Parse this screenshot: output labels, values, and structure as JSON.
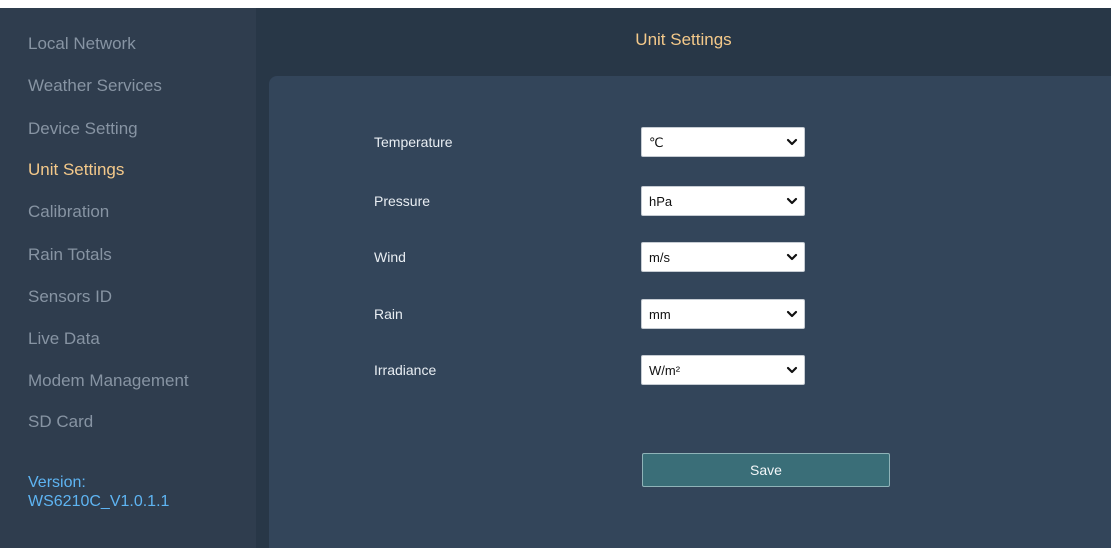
{
  "sidebar": {
    "items": [
      {
        "label": "Local Network",
        "active": false
      },
      {
        "label": "Weather Services",
        "active": false
      },
      {
        "label": "Device Setting",
        "active": false
      },
      {
        "label": "Unit Settings",
        "active": true
      },
      {
        "label": "Calibration",
        "active": false
      },
      {
        "label": "Rain Totals",
        "active": false
      },
      {
        "label": "Sensors ID",
        "active": false
      },
      {
        "label": "Live Data",
        "active": false
      },
      {
        "label": "Modem Management",
        "active": false
      },
      {
        "label": "SD Card",
        "active": false
      }
    ],
    "version_label": "Version:",
    "version_value": "WS6210C_V1.0.1.1"
  },
  "header": {
    "title": "Unit Settings"
  },
  "form": {
    "fields": [
      {
        "label": "Temperature",
        "value": "℃"
      },
      {
        "label": "Pressure",
        "value": "hPa"
      },
      {
        "label": "Wind",
        "value": "m/s"
      },
      {
        "label": "Rain",
        "value": "mm"
      },
      {
        "label": "Irradiance",
        "value": "W/m²"
      }
    ],
    "save_label": "Save"
  },
  "colors": {
    "background": "#283747",
    "sidebar": "#2f3d4e",
    "panel": "#33455a",
    "accent": "#f4c98a",
    "nav_text": "#8794a3",
    "version_text": "#5eb4f2",
    "save_button": "#3a6e78"
  },
  "icons": {
    "select_arrow": "chevron-down-icon"
  }
}
